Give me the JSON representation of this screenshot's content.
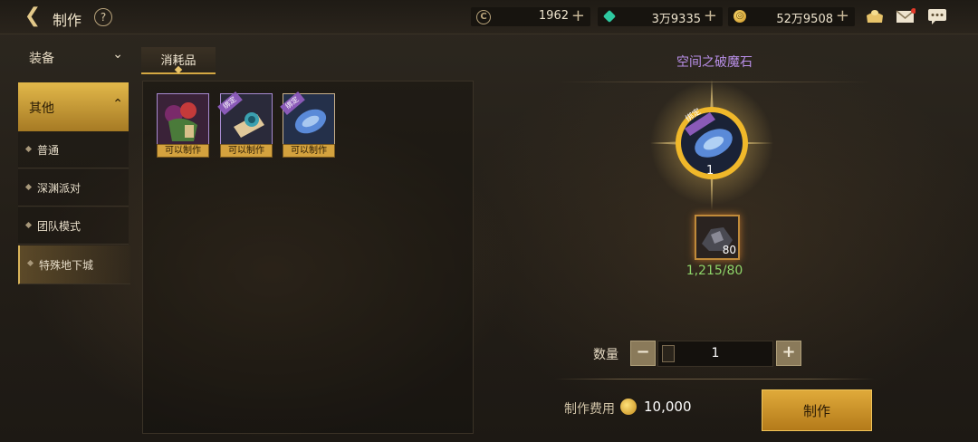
{
  "header": {
    "back_icon": "back-arrow-icon",
    "title": "制作",
    "help_label": "?",
    "currencies": [
      {
        "name": "credit",
        "icon": "credit-coin-icon",
        "value": "1962"
      },
      {
        "name": "gem",
        "icon": "green-gem-icon",
        "value": "3万9335"
      },
      {
        "name": "gold",
        "icon": "gold-coin-icon",
        "value": "52万9508"
      }
    ],
    "icons": [
      "shop-icon",
      "mail-icon",
      "chat-icon"
    ]
  },
  "menu": {
    "sections": [
      {
        "label": "装备",
        "expanded": false
      },
      {
        "label": "其他",
        "expanded": true
      }
    ],
    "items": [
      {
        "label": "普通",
        "selected": false
      },
      {
        "label": "深渊派对",
        "selected": false
      },
      {
        "label": "团队模式",
        "selected": false
      },
      {
        "label": "特殊地下城",
        "selected": true
      }
    ]
  },
  "tabs": [
    {
      "label": "消耗品",
      "active": true
    }
  ],
  "items": [
    {
      "icon": "potion-bag-icon",
      "badge": "可以制作",
      "bound": false
    },
    {
      "icon": "scroll-bag-icon",
      "badge": "可以制作",
      "bound": true,
      "bound_label": "绑定"
    },
    {
      "icon": "blue-stone-icon",
      "badge": "可以制作",
      "bound": true,
      "bound_label": "绑定"
    }
  ],
  "detail": {
    "item_name": "空间之破魔石",
    "item_icon": "blue-stone-icon",
    "bound_label": "绑定",
    "output_count": "1",
    "material": {
      "icon": "dark-ore-icon",
      "count": "80",
      "requirement": "1,215/80"
    },
    "quantity_label": "数量",
    "quantity_value": "1",
    "minus_label": "−",
    "plus_label": "+",
    "cost_label": "制作费用",
    "cost_value": "10,000",
    "make_button": "制作"
  },
  "colors": {
    "accent_gold": "#d4a843",
    "item_name": "#b98fe8",
    "requirement_ok": "#8ed469"
  }
}
